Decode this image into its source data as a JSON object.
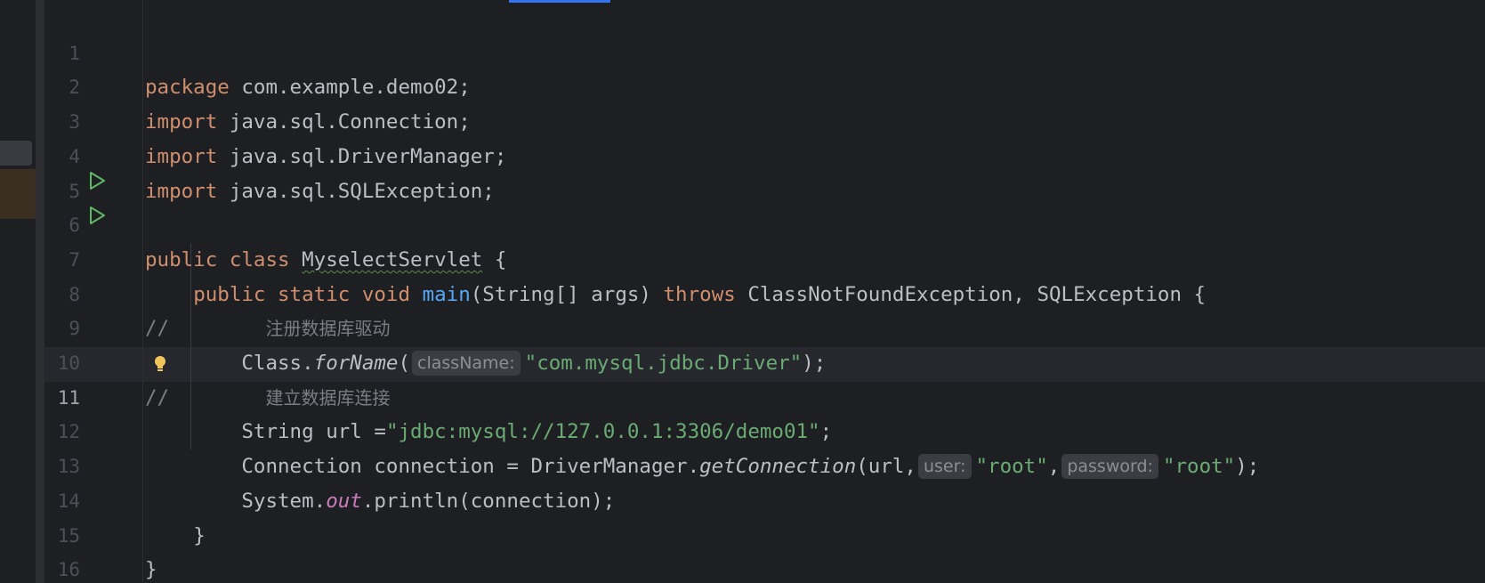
{
  "editor": {
    "line_numbers": [
      "1",
      "2",
      "3",
      "4",
      "5",
      "6",
      "7",
      "8",
      "9",
      "10",
      "11",
      "12",
      "13",
      "14",
      "15",
      "16"
    ],
    "current_line": "11",
    "code": {
      "l1": {
        "kw": "package",
        "rest": " com.example.demo02;"
      },
      "l2": {
        "kw": "import",
        "rest": " java.sql.Connection;"
      },
      "l3": {
        "kw": "import",
        "rest": " java.sql.DriverManager;"
      },
      "l4": {
        "kw": "import",
        "rest": " java.sql.SQLException;"
      },
      "l6": {
        "kw": "public class",
        "classname": "MyselectServlet",
        "rest": " {"
      },
      "l7": {
        "indent": "    ",
        "kw": "public static void",
        "fn": "main",
        "mid": "(String[] args) ",
        "kw2": "throws",
        "rest": " ClassNotFoundException, SQLException {"
      },
      "l8": {
        "comment": "//",
        "indent": "        ",
        "text": "注册数据库驱动"
      },
      "l9": {
        "indent": "        ",
        "obj": "Class.",
        "method": "forName",
        "open": "(",
        "hint": "className:",
        "str": "\"com.mysql.jdbc.Driver\"",
        "close": ");"
      },
      "l10": {
        "comment": "//",
        "indent": "        ",
        "text": "建立数据库连接"
      },
      "l11": {
        "indent": "        ",
        "pre": "String url =",
        "str": "\"jdbc:mysql://127.0.0.1:3306/demo01\"",
        "close": ";"
      },
      "l12": {
        "indent": "        ",
        "pre": "Connection connection = DriverManager.",
        "method": "getConnection",
        "open": "(url,",
        "hint1": "user:",
        "str1": "\"root\"",
        "comma": ",",
        "hint2": "password:",
        "str2": "\"root\"",
        "close": ");"
      },
      "l13": {
        "indent": "        ",
        "pre": "System.",
        "field": "out",
        "rest": ".println(connection);"
      },
      "l14": {
        "indent": "    ",
        "text": "}"
      },
      "l15": {
        "text": "}"
      }
    }
  },
  "colors": {
    "background": "#1e1f22",
    "keyword": "#cf8e6d",
    "string": "#6aab73",
    "function": "#56a8f5",
    "field": "#c77dbb",
    "comment": "#7a7e85",
    "line_number": "#4b5059",
    "run_icon": "#5fb865",
    "accent": "#3574f0"
  },
  "icons": {
    "run_class": "run-icon",
    "run_main": "run-icon",
    "intention": "lightbulb-icon"
  }
}
